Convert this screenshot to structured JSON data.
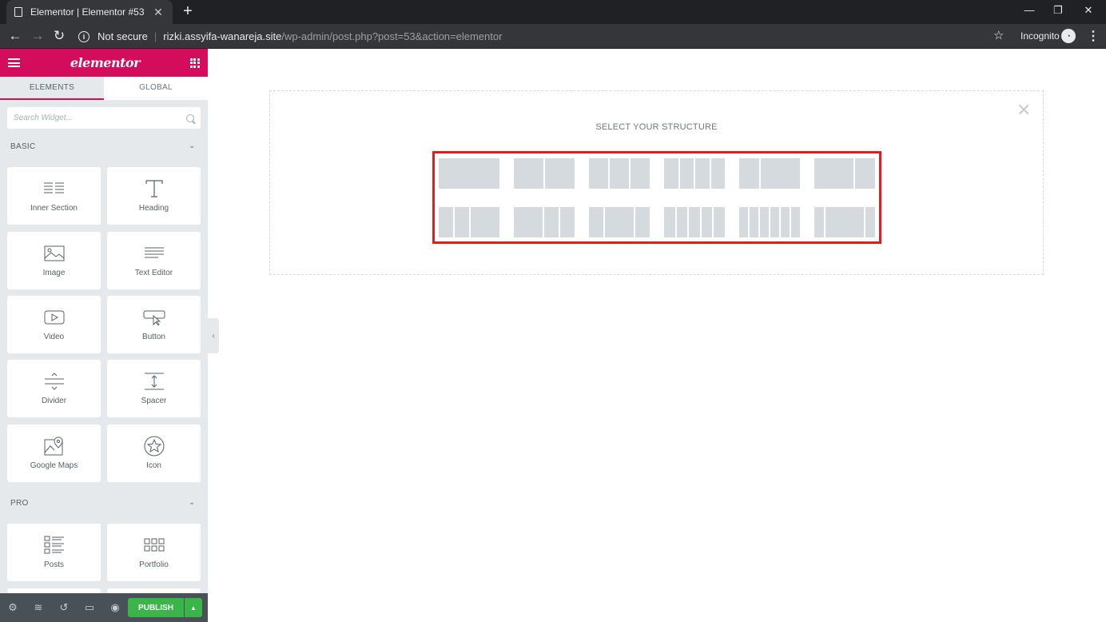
{
  "browser": {
    "tab_title": "Elementor | Elementor #53",
    "tab_close": "✕",
    "new_tab": "+",
    "window_controls": [
      "—",
      "❐",
      "✕"
    ],
    "security_label": "Not secure",
    "url_host": "rizki.assyifa-wanareja.site",
    "url_path": "/wp-admin/post.php?post=53&action=elementor",
    "profile_label": "Incognito"
  },
  "panel": {
    "logo": "elementor",
    "tabs": [
      "ELEMENTS",
      "GLOBAL"
    ],
    "search_placeholder": "Search Widget...",
    "categories": [
      "BASIC",
      "PRO"
    ],
    "basic_widgets": [
      "Inner Section",
      "Heading",
      "Image",
      "Text Editor",
      "Video",
      "Button",
      "Divider",
      "Spacer",
      "Google Maps",
      "Icon"
    ],
    "pro_widgets": [
      "Posts",
      "Portfolio"
    ],
    "footer": {
      "icons": [
        "gear-icon",
        "layers-icon",
        "history-icon",
        "responsive-icon",
        "eye-icon"
      ],
      "publish_label": "PUBLISH"
    }
  },
  "canvas": {
    "structure_title": "SELECT YOUR STRUCTURE",
    "close_glyph": "✕",
    "presets_row1": [
      [
        100
      ],
      [
        50,
        50
      ],
      [
        33,
        33,
        33
      ],
      [
        25,
        25,
        25,
        25
      ],
      [
        33,
        66
      ],
      [
        66,
        33
      ]
    ],
    "presets_row2": [
      [
        25,
        25,
        50
      ],
      [
        50,
        25,
        25
      ],
      [
        25,
        50,
        25
      ],
      [
        20,
        20,
        20,
        20,
        20
      ],
      [
        16,
        16,
        16,
        16,
        16,
        16
      ],
      [
        16,
        66,
        16
      ]
    ],
    "highlight_color": "#e41c1c"
  },
  "colors": {
    "brand": "#d30c5c",
    "publish": "#39b54a"
  }
}
